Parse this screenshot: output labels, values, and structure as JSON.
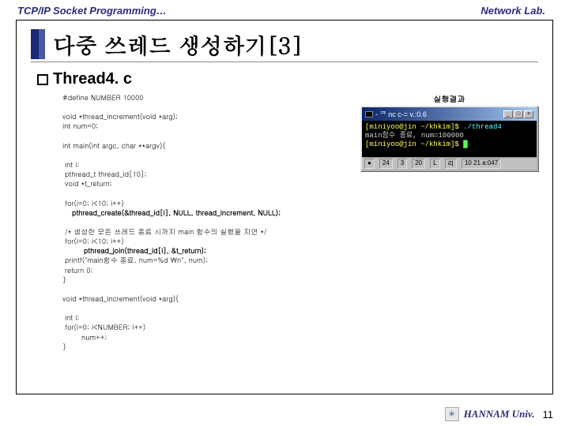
{
  "header": {
    "left": "TCP/IP Socket Programming…",
    "right": "Network Lab."
  },
  "title": "다중 쓰레드 생성하기[3]",
  "subhead": "Thread4. c",
  "result_label": "실행결과",
  "terminal": {
    "title": "- ᄏ nc c‑= v.:0.6",
    "body_line1_a": "[miniyoo@jin ~/khkim]$ ",
    "body_line1_b": "./thread4",
    "body_line2": "main함수 종료, num=100000",
    "body_line3_a": "[miniyoo@jin ~/khkim]$ ",
    "status": [
      "●",
      "24",
      "3",
      "20",
      "L",
      "리",
      "10 21 a:047"
    ]
  },
  "code": {
    "l1": "#define NUMBER 10000",
    "l2": "",
    "l3": "void *thread_increment(void *arg);",
    "l4": "int num=0;",
    "l5": "",
    "l6": "int main(int argc, char **argv){",
    "l7": "",
    "l8": " int i;",
    "l9": " pthread_t thread_id[10];",
    "l10": " void *t_return;",
    "l11": "",
    "l12": " for(i=0; i<10; i++)",
    "l13": "    pthread_create(&thread_id[i], NULL, thread_increment, NULL);",
    "l14": "",
    "l15": " /* 생성한 모든 쓰레드 종료 시까지 main 함수의 실행을 지연 */",
    "l16": " for(i=0; i<10; i++)",
    "l17": "         pthread_join(thread_id[i], &t_return);",
    "l18": " printf(\"main함수 종료, num=%d ₩n\", num);",
    "l19": " return 0;",
    "l20": "}",
    "l21": "",
    "l22": "void *thread_increment(void *arg){",
    "l23": "",
    "l24": " int i;",
    "l25": " for(i=0; i<NUMBER; i++)",
    "l26": "        num++;",
    "l27": "}"
  },
  "footer": {
    "text": "HANNAM Univ.",
    "page": "11"
  }
}
